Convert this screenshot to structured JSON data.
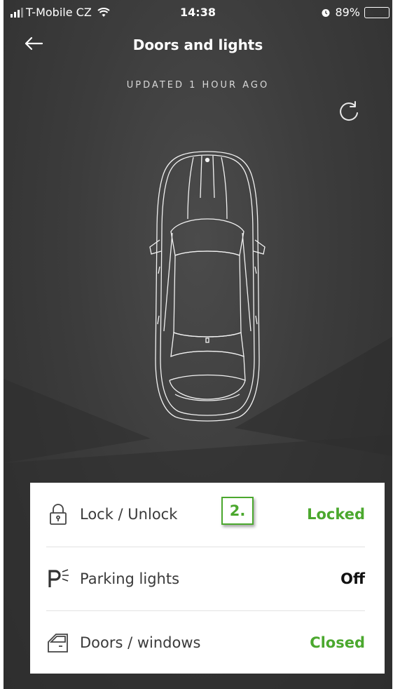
{
  "status_bar": {
    "carrier": "T-Mobile CZ",
    "time": "14:38",
    "battery": "89%",
    "battery_level": 0.89
  },
  "header": {
    "title": "Doors and lights",
    "subtitle": "UPDATED 1 HOUR AGO",
    "back_icon": "arrow-left-icon",
    "refresh_icon": "refresh-icon"
  },
  "status_card": {
    "rows": [
      {
        "icon": "padlock-icon",
        "label": "Lock / Unlock",
        "value": "Locked",
        "value_color": "#4ba82e"
      },
      {
        "icon": "parking-lights-icon",
        "label": "Parking lights",
        "value": "Off",
        "value_color": "#111111"
      },
      {
        "icon": "car-door-icon",
        "label": "Doors / windows",
        "value": "Closed",
        "value_color": "#4ba82e"
      }
    ],
    "step_marker": "2."
  },
  "colors": {
    "accent_green": "#4ba82e",
    "background": "#3c3c3c"
  }
}
